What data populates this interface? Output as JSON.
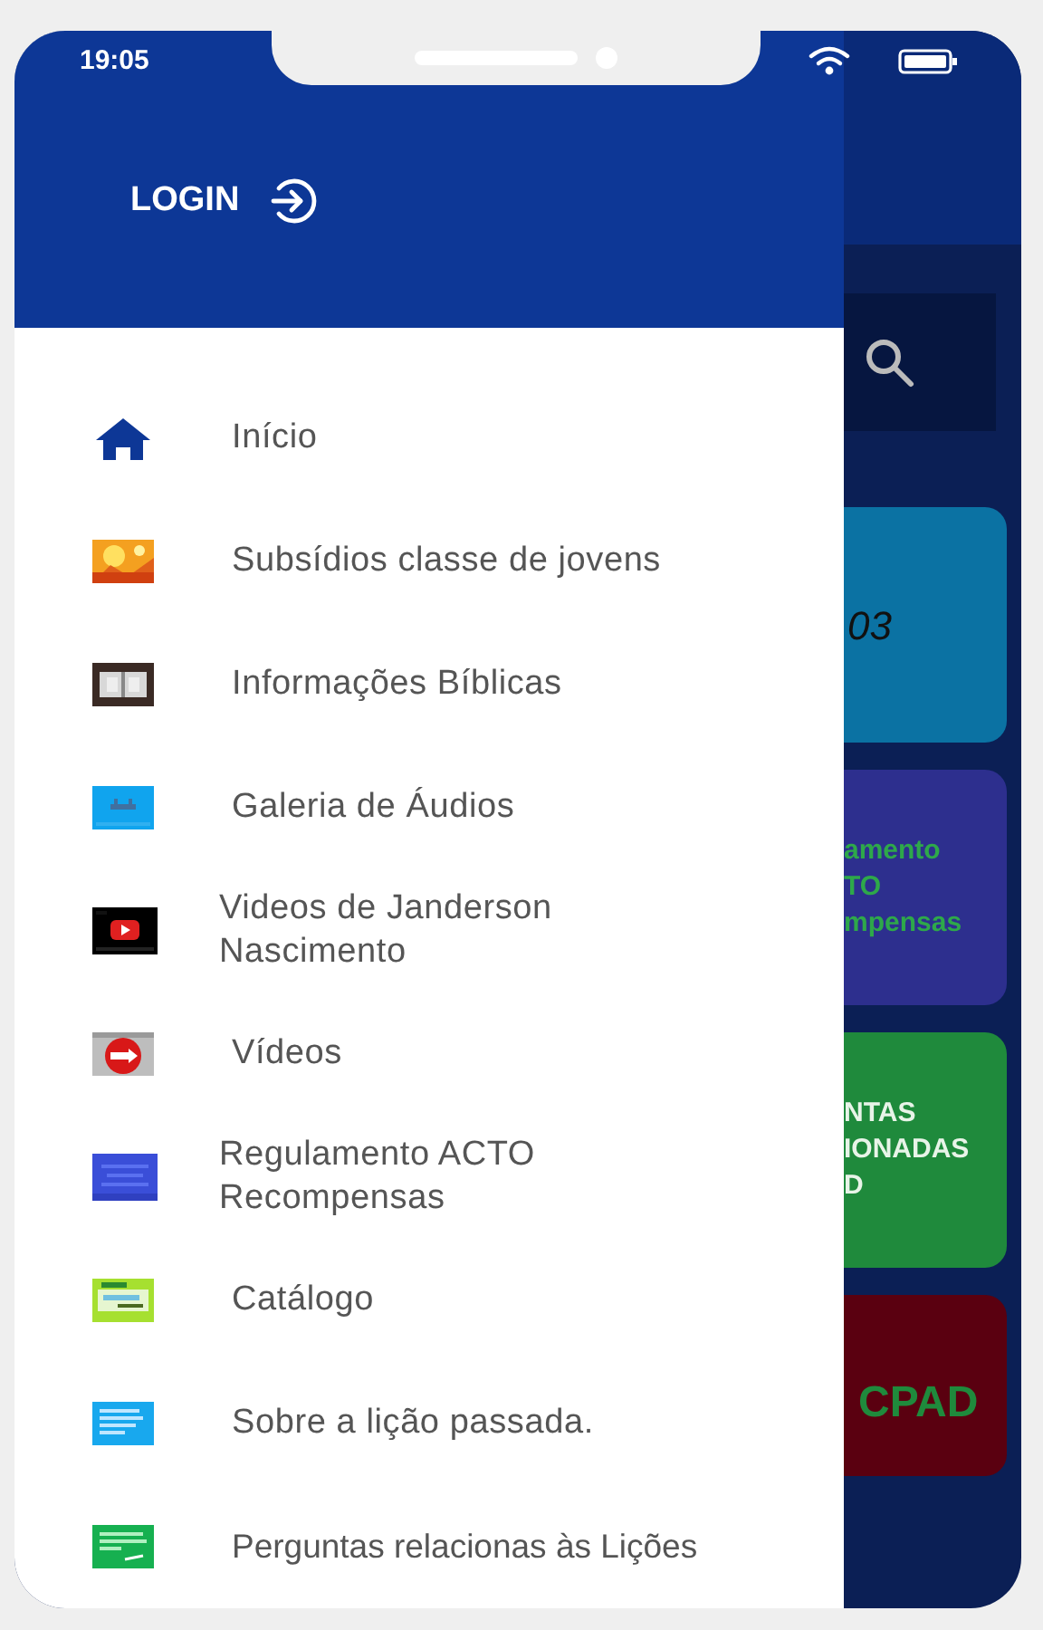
{
  "status_bar": {
    "time": "19:05"
  },
  "drawer": {
    "login_label": "LOGIN",
    "items": [
      {
        "kind": "home",
        "label": "Início"
      },
      {
        "kind": "picture",
        "label": "Subsídios classe de jovens"
      },
      {
        "kind": "picture",
        "label": "Informações Bíblicas"
      },
      {
        "kind": "picture",
        "label": "Galeria de Áudios"
      },
      {
        "kind": "picture",
        "label": "Videos de Janderson Nascimento"
      },
      {
        "kind": "picture",
        "label": "Vídeos"
      },
      {
        "kind": "picture",
        "label": "Regulamento ACTO Recompensas"
      },
      {
        "kind": "picture",
        "label": "Catálogo"
      },
      {
        "kind": "picture",
        "label": "Sobre a lição passada."
      },
      {
        "kind": "picture",
        "label": "Perguntas relacionas às Lições"
      }
    ]
  },
  "background_cards": [
    {
      "color": "#0b72a3",
      "lines": [
        "03"
      ]
    },
    {
      "color": "#2d2f8e",
      "lines": [
        "amento",
        "TO",
        "mpensas"
      ]
    },
    {
      "color": "#1f8a3c",
      "lines": [
        "NTAS",
        "IONADAS",
        "D"
      ]
    },
    {
      "color": "#5a0010",
      "lines": [
        "CPAD"
      ]
    }
  ]
}
